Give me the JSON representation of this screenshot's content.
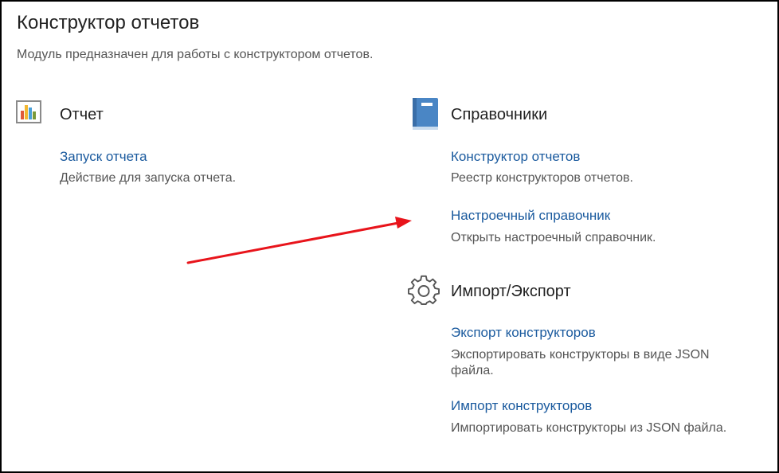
{
  "page": {
    "title": "Конструктор отчетов",
    "subtitle": "Модуль предназначен для работы с конструктором отчетов."
  },
  "sections": {
    "report": {
      "title": "Отчет",
      "icon": "bar-chart-icon",
      "items": [
        {
          "link": "Запуск отчета",
          "desc": "Действие для запуска отчета."
        }
      ]
    },
    "references": {
      "title": "Справочники",
      "icon": "book-icon",
      "items": [
        {
          "link": "Конструктор отчетов",
          "desc": "Реестр конструкторов отчетов."
        },
        {
          "link": "Настроечный справочник",
          "desc": "Открыть настроечный справочник."
        }
      ]
    },
    "import_export": {
      "title": "Импорт/Экспорт",
      "icon": "gear-icon",
      "items": [
        {
          "link": "Экспорт конструкторов",
          "desc_line1": "Экспортировать конструкторы в виде JSON",
          "desc_line2": "файла."
        },
        {
          "link": "Импорт конструкторов",
          "desc": "Импортировать конструкторы из JSON файла."
        }
      ]
    }
  },
  "colors": {
    "link": "#1a5a9e",
    "annotation_arrow": "#e8141b",
    "book_icon": "#4a86c5"
  }
}
